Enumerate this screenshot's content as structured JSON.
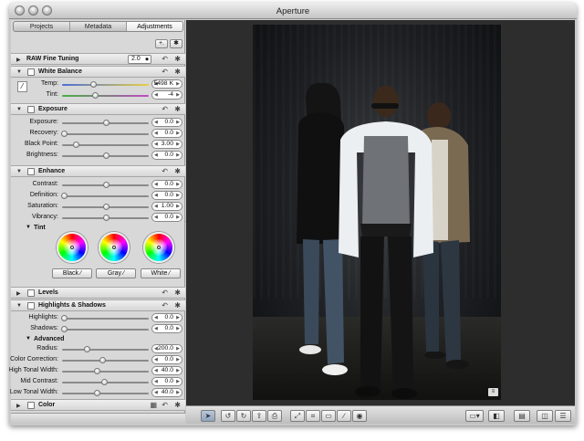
{
  "window": {
    "title": "Aperture"
  },
  "tabs": [
    {
      "label": "Projects",
      "selected": false
    },
    {
      "label": "Metadata",
      "selected": false
    },
    {
      "label": "Adjustments",
      "selected": true
    }
  ],
  "panel_toolbar": {
    "add_label": "+.",
    "gear": "gear-icon"
  },
  "raw": {
    "title": "RAW Fine Tuning",
    "version": "2.0"
  },
  "white_balance": {
    "title": "White Balance",
    "temp": {
      "label": "Temp:",
      "value": "5498 K",
      "level": 0.36
    },
    "tint": {
      "label": "Tint:",
      "value": "-4",
      "level": 0.38
    }
  },
  "exposure": {
    "title": "Exposure",
    "rows": [
      {
        "label": "Exposure:",
        "value": "0.0",
        "level": 0.5
      },
      {
        "label": "Recovery:",
        "value": "0.0",
        "level": 0.02
      },
      {
        "label": "Black Point:",
        "value": "3.00",
        "level": 0.16
      },
      {
        "label": "Brightness:",
        "value": "0.0",
        "level": 0.5
      }
    ]
  },
  "enhance": {
    "title": "Enhance",
    "rows": [
      {
        "label": "Contrast:",
        "value": "0.0",
        "level": 0.5
      },
      {
        "label": "Definition:",
        "value": "0.0",
        "level": 0.02
      },
      {
        "label": "Saturation:",
        "value": "1.00",
        "level": 0.5
      },
      {
        "label": "Vibrancy:",
        "value": "0.0",
        "level": 0.5
      }
    ],
    "tint_label": "Tint",
    "wheels": [
      {
        "button": "Black"
      },
      {
        "button": "Gray"
      },
      {
        "button": "White"
      }
    ]
  },
  "levels": {
    "title": "Levels"
  },
  "highlights": {
    "title": "Highlights & Shadows",
    "rows": [
      {
        "label": "Highlights:",
        "value": "0.0",
        "level": 0.02
      },
      {
        "label": "Shadows:",
        "value": "0.0",
        "level": 0.02
      }
    ],
    "advanced_label": "Advanced",
    "advanced_rows": [
      {
        "label": "Radius:",
        "value": "200.0",
        "level": 0.28
      },
      {
        "label": "Color Correction:",
        "value": "0.0",
        "level": 0.46
      },
      {
        "label": "High Tonal Width:",
        "value": "40.0",
        "level": 0.4
      },
      {
        "label": "Mid Contrast:",
        "value": "0.0",
        "level": 0.48
      },
      {
        "label": "Low Tonal Width:",
        "value": "40.0",
        "level": 0.4
      }
    ]
  },
  "color": {
    "title": "Color"
  },
  "viewer": {
    "badge": "metadata-overlay-icon"
  },
  "colors": {
    "window_bg": "#c9c9c9",
    "viewer_bg": "#2d2d2d",
    "panel_bg": "#d8d8d8"
  }
}
